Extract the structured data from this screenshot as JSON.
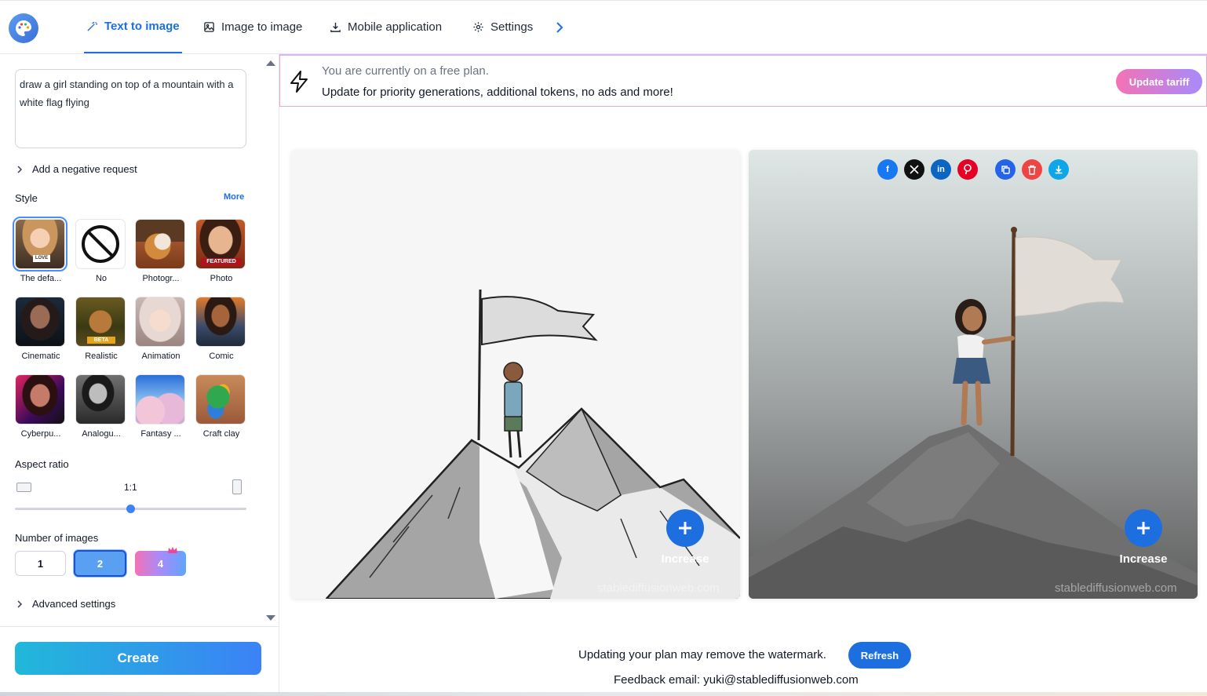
{
  "nav": {
    "tabs": [
      {
        "label": "Text to image",
        "active": true
      },
      {
        "label": "Image to image"
      },
      {
        "label": "Mobile application"
      },
      {
        "label": "Settings"
      }
    ]
  },
  "sidebar": {
    "prompt": "draw a girl standing on top of a mountain with a white flag flying",
    "negative_label": "Add a negative request",
    "style_label": "Style",
    "more_label": "More",
    "styles": [
      {
        "name": "The defa...",
        "selected": true,
        "badge": "LOVE"
      },
      {
        "name": "No"
      },
      {
        "name": "Photogr..."
      },
      {
        "name": "Photo",
        "badge": "FEATURED"
      },
      {
        "name": "Cinematic"
      },
      {
        "name": "Realistic",
        "badge": "BETA"
      },
      {
        "name": "Animation"
      },
      {
        "name": "Comic"
      },
      {
        "name": "Cyberpu..."
      },
      {
        "name": "Analogu..."
      },
      {
        "name": "Fantasy ..."
      },
      {
        "name": "Craft clay"
      }
    ],
    "aspect_label": "Aspect ratio",
    "aspect_value": "1:1",
    "aspect_slider_fraction": 0.5,
    "count_label": "Number of images",
    "counts": [
      "1",
      "2",
      "4"
    ],
    "selected_count": "2",
    "advanced_label": "Advanced settings",
    "create_label": "Create"
  },
  "banner": {
    "line1": "You are currently on a free plan.",
    "line2": "Update for priority generations, additional tokens, no ads and more!",
    "button": "Update tariff"
  },
  "results": {
    "increase_label": "Increase",
    "watermark": "stablediffusionweb.com",
    "share_icons": [
      "facebook-icon",
      "x-icon",
      "linkedin-icon",
      "pinterest-icon",
      "copy-icon",
      "delete-icon",
      "download-icon"
    ]
  },
  "footer": {
    "watermark_text": "Updating your plan may remove the watermark.",
    "refresh_label": "Refresh",
    "feedback": "Feedback email: yuki@stablediffusionweb.com"
  },
  "colors": {
    "accent": "#1d6fe0",
    "create_gradient_start": "#21b8d9",
    "create_gradient_end": "#3b82f6",
    "premium_pink": "#f472b6"
  }
}
